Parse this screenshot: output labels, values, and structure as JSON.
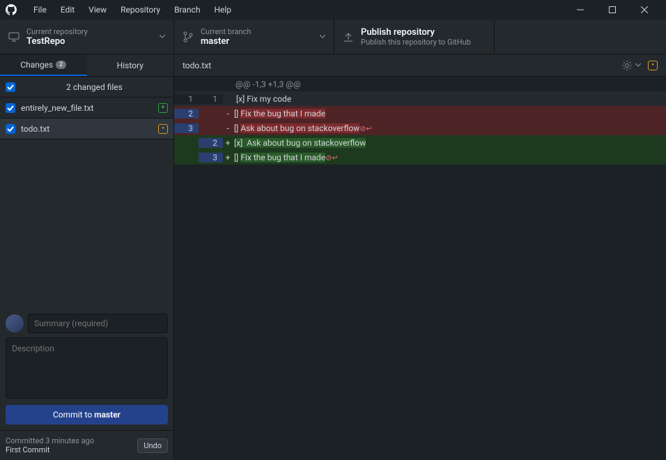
{
  "menu": {
    "items": [
      "File",
      "Edit",
      "View",
      "Repository",
      "Branch",
      "Help"
    ]
  },
  "toolbar": {
    "repo": {
      "label": "Current repository",
      "value": "TestRepo"
    },
    "branch": {
      "label": "Current branch",
      "value": "master"
    },
    "publish": {
      "title": "Publish repository",
      "sub": "Publish this repository to GitHub"
    }
  },
  "tabs": {
    "changes": "Changes",
    "changes_count": "2",
    "history": "History"
  },
  "filelist": {
    "header": "2 changed files",
    "files": [
      {
        "name": "entirely_new_file.txt",
        "status": "add",
        "selected": false
      },
      {
        "name": "todo.txt",
        "status": "mod",
        "selected": true
      }
    ]
  },
  "commit": {
    "summary_placeholder": "Summary (required)",
    "desc_placeholder": "Description",
    "button_prefix": "Commit to ",
    "button_branch": "master"
  },
  "last_commit": {
    "time": "Committed 3 minutes ago",
    "msg": "First Commit",
    "undo": "Undo"
  },
  "diff": {
    "filename": "todo.txt",
    "hunk": "@@ -1,3 +1,3 @@",
    "lines": [
      {
        "type": "ctx",
        "old": "1",
        "new": "1",
        "text": "[x] Fix my code"
      },
      {
        "type": "del",
        "old": "2",
        "new": "",
        "pre": "[] ",
        "hl": "Fix the bug that I made",
        "post": ""
      },
      {
        "type": "del",
        "old": "3",
        "new": "",
        "pre": "[] ",
        "hl": "Ask about bug on stackoverflow",
        "post": "",
        "noeol": true
      },
      {
        "type": "add",
        "old": "",
        "new": "2",
        "pre": "[",
        "hl": "x]  Ask about bug on stackoverflow",
        "post": ""
      },
      {
        "type": "add",
        "old": "",
        "new": "3",
        "pre": "[] ",
        "hl": "Fix the bug that I made",
        "post": "",
        "noeol": true
      }
    ]
  }
}
